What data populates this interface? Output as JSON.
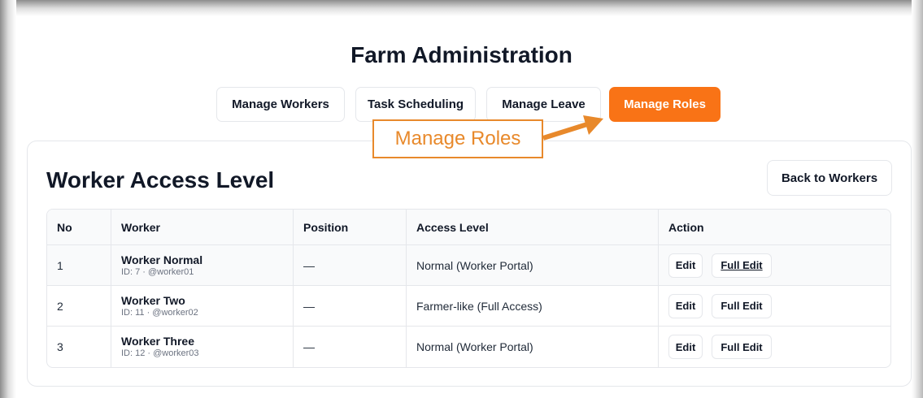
{
  "page": {
    "title": "Farm Administration"
  },
  "nav": {
    "items": [
      {
        "label": "Manage Workers",
        "active": false
      },
      {
        "label": "Task Scheduling",
        "active": false
      },
      {
        "label": "Manage Leave",
        "active": false
      },
      {
        "label": "Manage Roles",
        "active": true
      }
    ]
  },
  "section": {
    "title": "Worker Access Level",
    "back_label": "Back to Workers"
  },
  "table": {
    "columns": [
      "No",
      "Worker",
      "Position",
      "Access Level",
      "Action"
    ],
    "rows": [
      {
        "no": "1",
        "name": "Worker Normal",
        "id": "ID: 7 · @worker01",
        "position": "—",
        "access": "Normal (Worker Portal)",
        "edit": "Edit",
        "full_edit": "Full Edit"
      },
      {
        "no": "2",
        "name": "Worker Two",
        "id": "ID: 11 · @worker02",
        "position": "—",
        "access": "Farmer-like (Full Access)",
        "edit": "Edit",
        "full_edit": "Full Edit"
      },
      {
        "no": "3",
        "name": "Worker Three",
        "id": "ID: 12 · @worker03",
        "position": "—",
        "access": "Normal (Worker Portal)",
        "edit": "Edit",
        "full_edit": "Full Edit"
      }
    ]
  },
  "callout": {
    "label": "Manage Roles",
    "color": "#e8892b"
  },
  "colors": {
    "accent": "#f97316"
  }
}
